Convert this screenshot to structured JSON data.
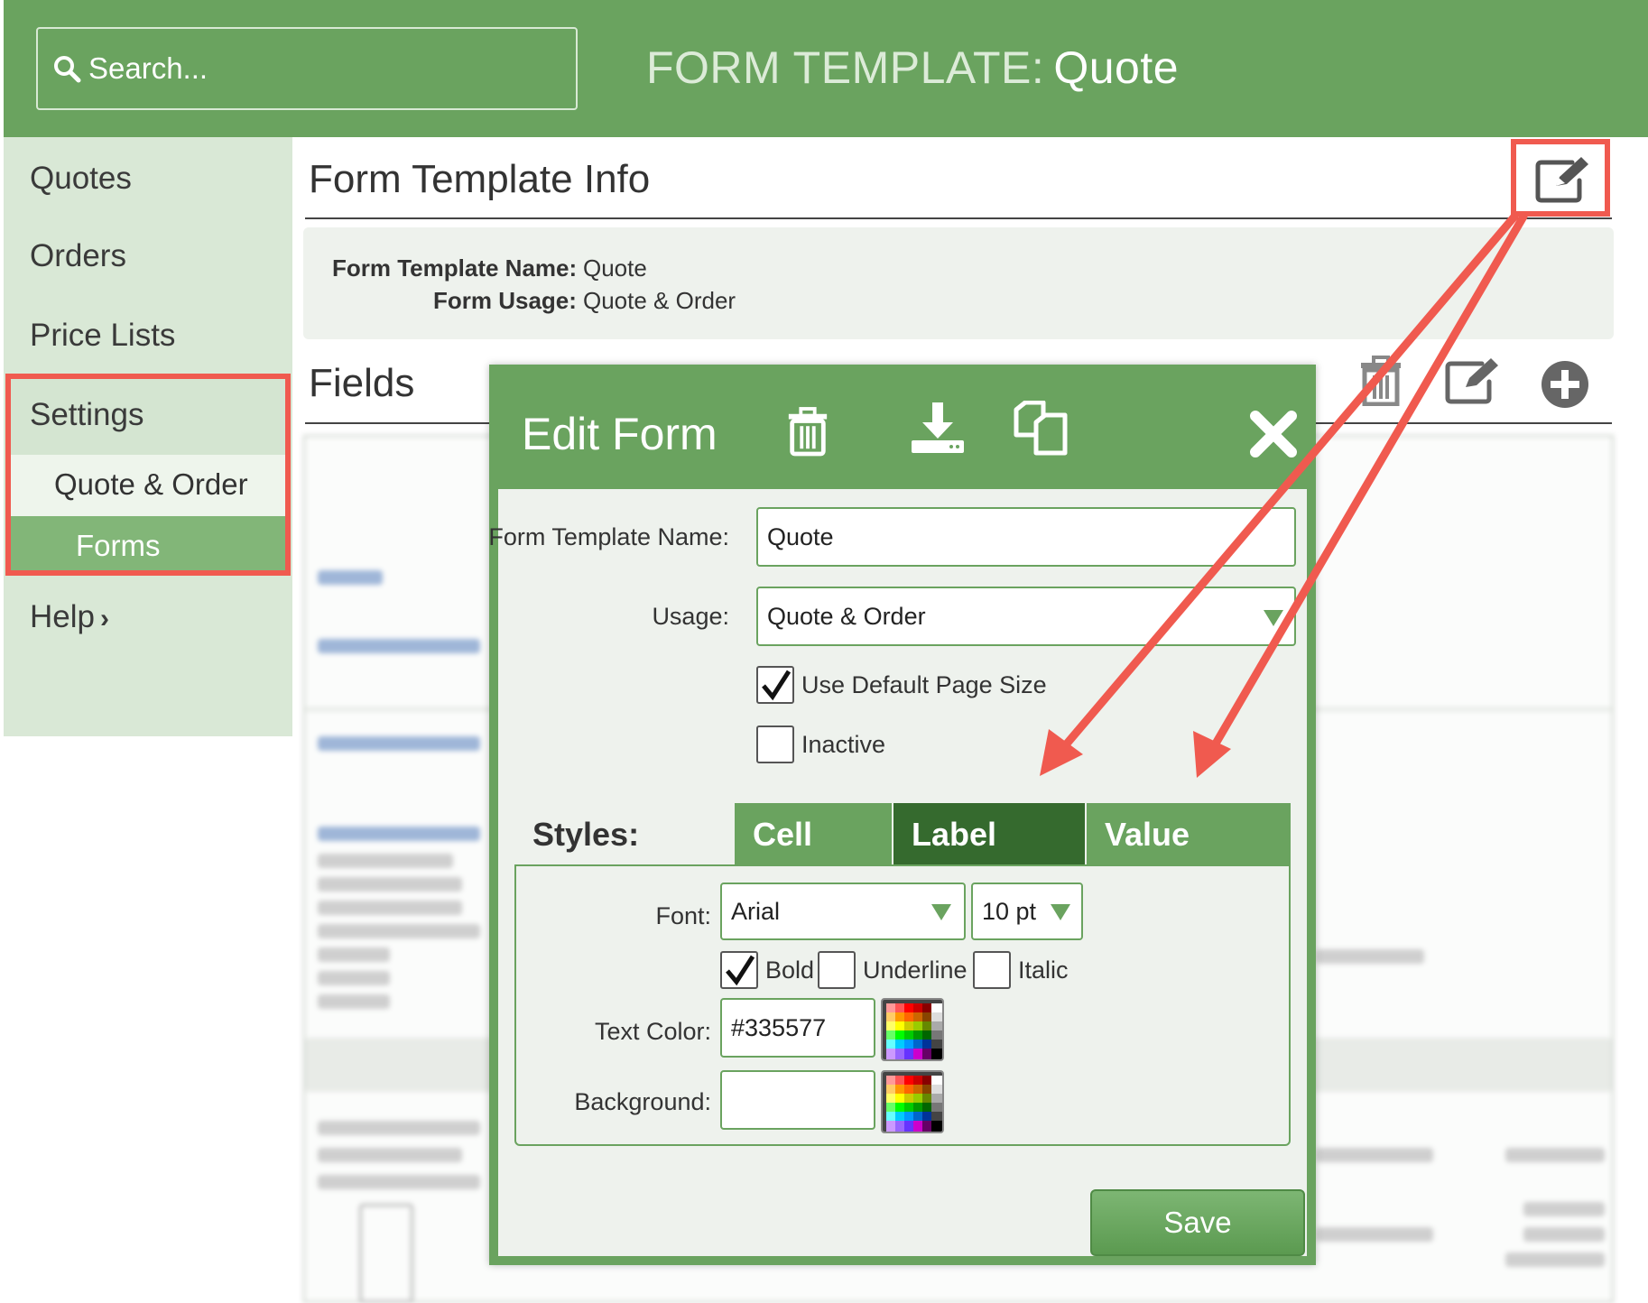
{
  "header": {
    "search_placeholder": "Search...",
    "title_prefix": "FORM TEMPLATE:",
    "title_value": "Quote"
  },
  "sidebar": {
    "items": [
      {
        "label": "Quotes"
      },
      {
        "label": "Orders"
      },
      {
        "label": "Price Lists"
      },
      {
        "label": "Settings"
      },
      {
        "label": "Quote & Order"
      },
      {
        "label": "Forms"
      },
      {
        "label": "Help"
      }
    ]
  },
  "info": {
    "title": "Form Template Info",
    "name_label": "Form Template Name:",
    "name_value": "Quote",
    "usage_label": "Form Usage:",
    "usage_value": "Quote & Order"
  },
  "fields": {
    "title": "Fields"
  },
  "dialog": {
    "title": "Edit Form",
    "name_label": "Form Template Name:",
    "name_value": "Quote",
    "usage_label": "Usage:",
    "usage_value": "Quote & Order",
    "default_page_size_label": "Use Default Page Size",
    "default_page_size_checked": true,
    "inactive_label": "Inactive",
    "inactive_checked": false,
    "styles_label": "Styles:",
    "tabs": [
      {
        "label": "Cell"
      },
      {
        "label": "Label"
      },
      {
        "label": "Value"
      }
    ],
    "active_tab": "Label",
    "font_label": "Font:",
    "font_value": "Arial",
    "size_value": "10 pt",
    "bold_label": "Bold",
    "bold_checked": true,
    "underline_label": "Underline",
    "underline_checked": false,
    "italic_label": "Italic",
    "italic_checked": false,
    "text_color_label": "Text Color:",
    "text_color_value": "#335577",
    "background_label": "Background:",
    "background_value": "",
    "save_label": "Save"
  },
  "colors": {
    "brand_green": "#6aa35f",
    "active_tab": "#356a2e",
    "highlight_red": "#f05a4f",
    "sidebar_bg": "#d9e8d6"
  }
}
